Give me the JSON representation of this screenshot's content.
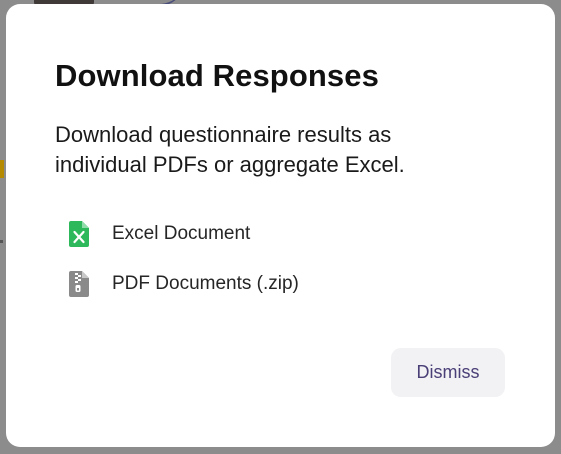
{
  "dialog": {
    "title": "Download Responses",
    "description": "Download questionnaire results as individual PDFs or aggregate Excel.",
    "options": [
      {
        "label": "Excel Document",
        "icon": "excel-file-icon",
        "color": "#2eb85c"
      },
      {
        "label": "PDF Documents (.zip)",
        "icon": "zip-file-icon",
        "color": "#8a8a8a"
      }
    ],
    "dismiss_label": "Dismiss"
  },
  "colors": {
    "overlay": "#8c8c8c",
    "dialog_background": "#ffffff",
    "dismiss_background": "#f2f2f4",
    "dismiss_text": "#4b3f77"
  }
}
